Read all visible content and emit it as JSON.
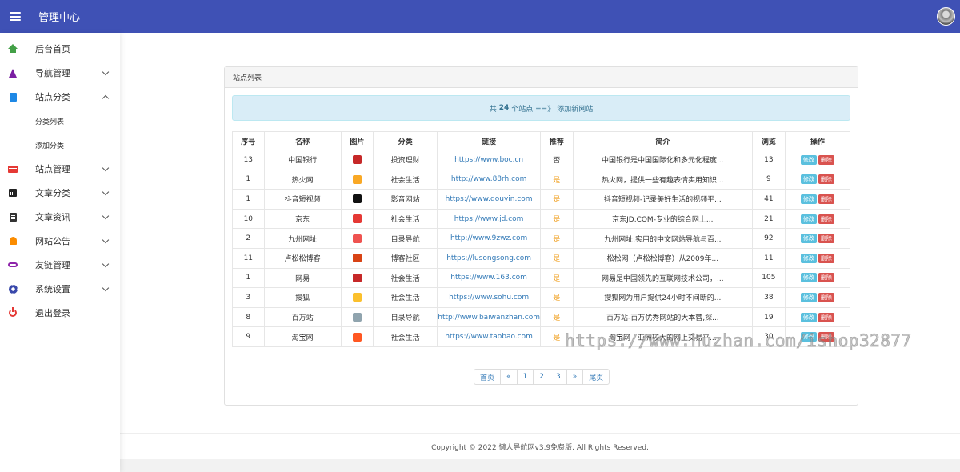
{
  "header": {
    "title": "管理中心"
  },
  "sidebar": {
    "items": [
      {
        "label": "后台首页"
      },
      {
        "label": "导航管理"
      },
      {
        "label": "站点分类",
        "sub": [
          "分类列表",
          "添加分类"
        ]
      },
      {
        "label": "站点管理"
      },
      {
        "label": "文章分类"
      },
      {
        "label": "文章资讯"
      },
      {
        "label": "网站公告"
      },
      {
        "label": "友链管理"
      },
      {
        "label": "系统设置"
      },
      {
        "label": "退出登录"
      }
    ]
  },
  "panel": {
    "title": "站点列表",
    "info_prefix": "共",
    "info_count": "24",
    "info_suffix": "个站点 ==》",
    "info_link": "添加新网站"
  },
  "table": {
    "headers": [
      "序号",
      "名称",
      "图片",
      "分类",
      "链接",
      "推荐",
      "简介",
      "浏览",
      "操作"
    ],
    "edit_label": "修改",
    "delete_label": "删除",
    "rows": [
      {
        "seq": "13",
        "name": "中国银行",
        "category": "投资理财",
        "url": "https://www.boc.cn",
        "rec": "否",
        "intro": "中国银行是中国国际化和多元化程度...",
        "views": "13",
        "logo": "#c62828"
      },
      {
        "seq": "1",
        "name": "热火网",
        "category": "社会生活",
        "url": "http://www.88rh.com",
        "rec": "是",
        "intro": "热火网，提供一些有趣表情实用知识...",
        "views": "9",
        "logo": "#f9a825"
      },
      {
        "seq": "1",
        "name": "抖音短视频",
        "category": "影音网站",
        "url": "https://www.douyin.com",
        "rec": "是",
        "intro": "抖音短视频-记录美好生活的视频平...",
        "views": "41",
        "logo": "#111111"
      },
      {
        "seq": "10",
        "name": "京东",
        "category": "社会生活",
        "url": "https://www.jd.com",
        "rec": "是",
        "intro": "京东JD.COM-专业的综合网上...",
        "views": "21",
        "logo": "#e53935"
      },
      {
        "seq": "2",
        "name": "九州网址",
        "category": "目录导航",
        "url": "http://www.9zwz.com",
        "rec": "是",
        "intro": "九州网址,实用的中文网站导航与百...",
        "views": "92",
        "logo": "#ef5350"
      },
      {
        "seq": "11",
        "name": "卢松松博客",
        "category": "博客社区",
        "url": "https://lusongsong.com",
        "rec": "是",
        "intro": "松松网（卢松松博客）从2009年...",
        "views": "11",
        "logo": "#d84315"
      },
      {
        "seq": "1",
        "name": "网易",
        "category": "社会生活",
        "url": "https://www.163.com",
        "rec": "是",
        "intro": "网易是中国领先的互联网技术公司，...",
        "views": "105",
        "logo": "#c62828"
      },
      {
        "seq": "3",
        "name": "搜狐",
        "category": "社会生活",
        "url": "https://www.sohu.com",
        "rec": "是",
        "intro": "搜狐网为用户提供24小时不间断的...",
        "views": "38",
        "logo": "#fbc02d"
      },
      {
        "seq": "8",
        "name": "百万站",
        "category": "目录导航",
        "url": "http://www.baiwanzhan.com",
        "rec": "是",
        "intro": "百万站-百万优秀网站的大本营,探...",
        "views": "19",
        "logo": "#90a4ae"
      },
      {
        "seq": "9",
        "name": "淘宝网",
        "category": "社会生活",
        "url": "https://www.taobao.com",
        "rec": "是",
        "intro": "淘宝网 - 亚洲较大的网上交易平...",
        "views": "30",
        "logo": "#ff5722"
      }
    ]
  },
  "pager": [
    "首页",
    "«",
    "1",
    "2",
    "3",
    "»",
    "尾页"
  ],
  "footer": {
    "text": "Copyright © 2022 懒人导航网v3.9免费版. All Rights Reserved."
  },
  "watermark": "https://www.huzhan.com/ishop32877"
}
